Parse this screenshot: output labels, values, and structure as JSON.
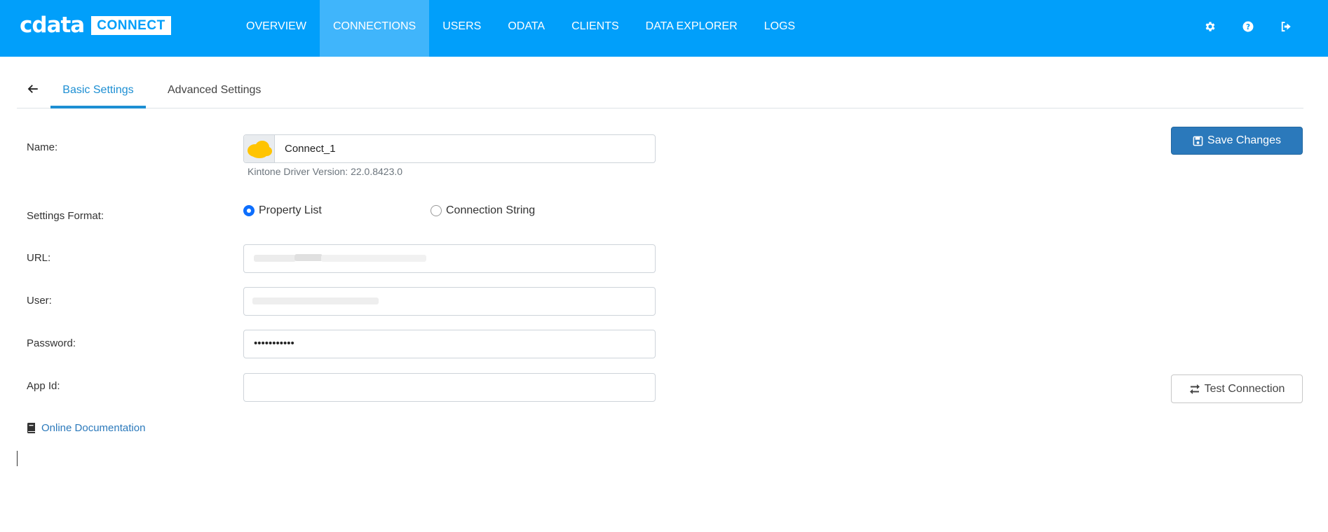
{
  "app": {
    "logo_text": "cdata",
    "logo_badge": "CONNECT"
  },
  "nav": {
    "items": [
      {
        "label": "OVERVIEW",
        "active": false
      },
      {
        "label": "CONNECTIONS",
        "active": true
      },
      {
        "label": "USERS",
        "active": false
      },
      {
        "label": "ODATA",
        "active": false
      },
      {
        "label": "CLIENTS",
        "active": false
      },
      {
        "label": "DATA EXPLORER",
        "active": false
      },
      {
        "label": "LOGS",
        "active": false
      }
    ],
    "icons": [
      "gear-icon",
      "help-icon",
      "sign-out-icon"
    ]
  },
  "tabs": {
    "back_icon": "arrow-left-icon",
    "basic": "Basic Settings",
    "advanced": "Advanced Settings",
    "active": "Basic Settings"
  },
  "form": {
    "name_label": "Name:",
    "name_value": "Connect_1",
    "driver_version": "Kintone Driver Version: 22.0.8423.0",
    "settings_format_label": "Settings Format:",
    "format_options": {
      "property_list": "Property List",
      "connection_string": "Connection String",
      "selected": "Property List"
    },
    "url_label": "URL:",
    "user_label": "User:",
    "password_label": "Password:",
    "password_value": "•••••••••••",
    "appid_label": "App Id:",
    "appid_value": ""
  },
  "buttons": {
    "save": "Save Changes",
    "test": "Test Connection"
  },
  "doc_link": "Online Documentation",
  "colors": {
    "topbar": "#019ffa",
    "nav_active": "#40b5fb",
    "accent": "#1d8fd3",
    "save_button": "#2b79bb",
    "link": "#2b79bb",
    "kintone_icon": "#ffc400"
  }
}
